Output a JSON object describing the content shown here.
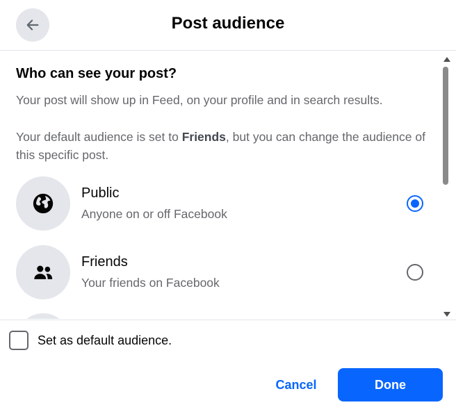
{
  "header": {
    "title": "Post audience",
    "back_icon": "arrow-left-icon"
  },
  "intro": {
    "heading": "Who can see your post?",
    "description": "Your post will show up in Feed, on your profile and in search results.",
    "default_prefix": "Your default audience is set to ",
    "default_value": "Friends",
    "default_suffix": ", but you can change the audience of this specific post."
  },
  "options": [
    {
      "title": "Public",
      "subtitle": "Anyone on or off Facebook",
      "icon": "globe-icon",
      "selected": true
    },
    {
      "title": "Friends",
      "subtitle": "Your friends on Facebook",
      "icon": "friends-icon",
      "selected": false
    }
  ],
  "footer": {
    "checkbox_label": "Set as default audience.",
    "checkbox_checked": false,
    "cancel_label": "Cancel",
    "done_label": "Done"
  },
  "colors": {
    "accent": "#0866ff",
    "secondary_text": "#65676b",
    "icon_bg": "#e4e6eb"
  }
}
